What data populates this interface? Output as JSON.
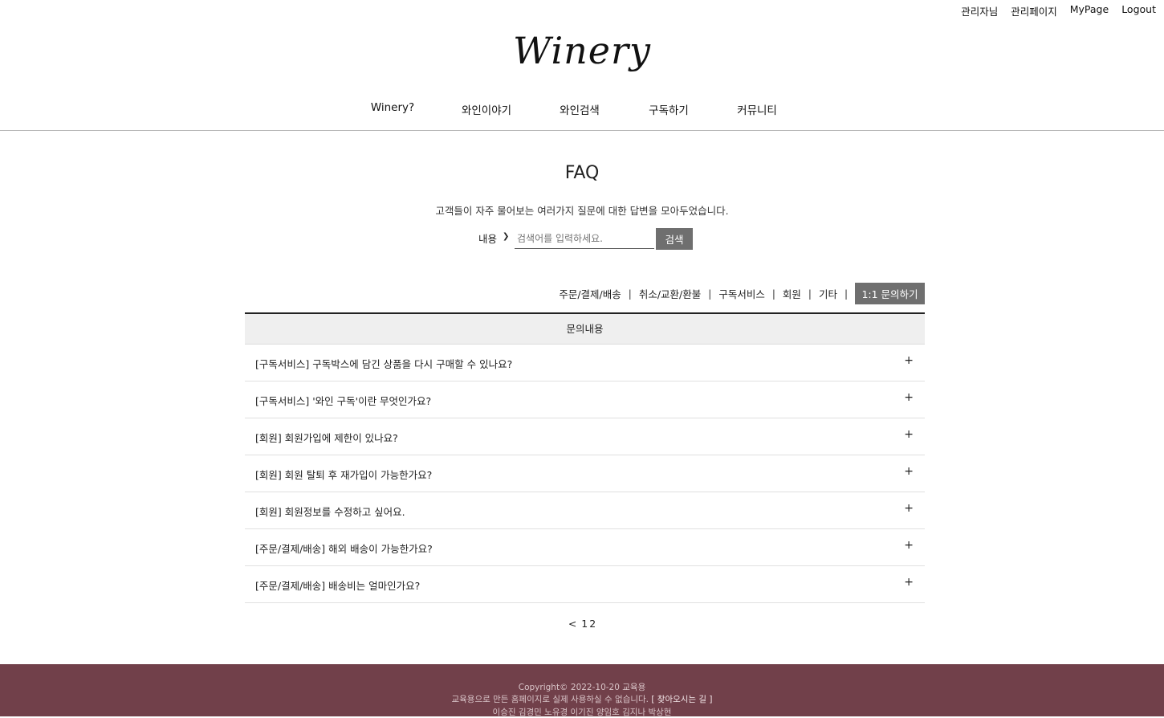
{
  "top_links": {
    "admin_name": "관리자님",
    "admin_page": "관리페이지",
    "mypage": "MyPage",
    "logout": "Logout"
  },
  "logo": "Winery",
  "nav": {
    "items": [
      "Winery?",
      "와인이야기",
      "와인검색",
      "구독하기",
      "커뮤니티"
    ]
  },
  "faq": {
    "title": "FAQ",
    "subtitle": "고객들이 자주 물어보는 여러가지 질문에 대한 답변을 모아두었습니다.",
    "search": {
      "select_value": "내용",
      "placeholder": "검색어를 입력하세요.",
      "button": "검색"
    },
    "categories": [
      "주문/결제/배송",
      "취소/교환/환불",
      "구독서비스",
      "회원",
      "기타"
    ],
    "separator": "|",
    "inquiry_button": "1:1 문의하기",
    "table_header": "문의내용",
    "expand_symbol": "+",
    "questions": [
      "[구독서비스] 구독박스에 담긴 상품을 다시 구매할 수 있나요?",
      "[구독서비스] '와인 구독'이란 무엇인가요?",
      "[회원] 회원가입에 제한이 있나요?",
      "[회원] 회원 탈퇴 후 재가입이 가능한가요?",
      "[회원] 회원정보를 수정하고 싶어요.",
      "[주문/결제/배송] 해외 배송이 가능한가요?",
      "[주문/결제/배송] 배송비는 얼마인가요?"
    ]
  },
  "pagination": {
    "prev": "<",
    "pages": [
      "1",
      "2"
    ]
  },
  "footer": {
    "copyright": "Copyright© 2022-10-20 교육용",
    "notice": "교육용으로 만든 홈페이지로 실제 사용하실 수 없습니다.",
    "directions_link": "[ 찾아오시는 길 ]",
    "members": "이승진 김경민 노유경 이기진 양임호 김지나 박상현"
  },
  "colors": {
    "footer_bg": "#71404a",
    "button_bg": "#6f6f6f"
  }
}
